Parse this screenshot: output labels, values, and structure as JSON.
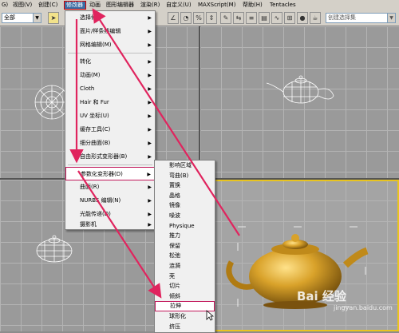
{
  "menubar": {
    "items": [
      {
        "label": "G)"
      },
      {
        "label": "视图(V)"
      },
      {
        "label": "创建(C)"
      },
      {
        "label": "修改器"
      },
      {
        "label": "动画"
      },
      {
        "label": "图形编辑器"
      },
      {
        "label": "渲染(R)"
      },
      {
        "label": "自定义(U)"
      },
      {
        "label": "MAXScript(M)"
      },
      {
        "label": "帮助(H)"
      },
      {
        "label": "Tentacles"
      }
    ]
  },
  "toolbar": {
    "filter_value": "全部",
    "selection_set_placeholder": "创建选择集",
    "colors": {
      "selected_tool": "#f2e28a"
    }
  },
  "modifiers_menu": {
    "items": [
      {
        "label": "选择修",
        "has_sub": true
      },
      {
        "label": "面片/样条线编辑",
        "has_sub": true
      },
      {
        "label": "网格编辑(M)",
        "has_sub": true
      },
      {
        "label": "转化",
        "has_sub": true
      },
      {
        "label": "动画(M)",
        "has_sub": true
      },
      {
        "label": "Cloth",
        "has_sub": true
      },
      {
        "label": "Hair 和 Fur",
        "has_sub": true
      },
      {
        "label": "UV 坐标(U)",
        "has_sub": true
      },
      {
        "label": "缓存工具(C)",
        "has_sub": true
      },
      {
        "label": "细分曲面(B)",
        "has_sub": true
      },
      {
        "label": "自由形式变形器(B)",
        "has_sub": true
      },
      {
        "label": "参数化变形器(D)",
        "has_sub": true,
        "highlighted": true
      },
      {
        "label": "曲面(R)",
        "has_sub": true
      },
      {
        "label": "NURBS 编辑(N)",
        "has_sub": true
      },
      {
        "label": "光能传递(D)",
        "has_sub": true
      },
      {
        "label": "摄影机",
        "has_sub": true
      }
    ]
  },
  "parametric_deformers_menu": {
    "items": [
      {
        "label": "影响区域"
      },
      {
        "label": "弯曲(B)"
      },
      {
        "label": "置换"
      },
      {
        "label": "晶格"
      },
      {
        "label": "镜像"
      },
      {
        "label": "噪波"
      },
      {
        "label": "Physique"
      },
      {
        "label": "推力"
      },
      {
        "label": "保留"
      },
      {
        "label": "松弛"
      },
      {
        "label": "涟漪"
      },
      {
        "label": "壳"
      },
      {
        "label": "切片"
      },
      {
        "label": "倾斜"
      },
      {
        "label": "拉伸",
        "highlighted": true
      },
      {
        "label": "球形化"
      },
      {
        "label": "挤压"
      }
    ]
  },
  "watermark": {
    "text": "Bai 经验",
    "sub": "jingyan.baidu.com"
  },
  "colors": {
    "arrow": "#e0245e",
    "highlight_border": "#c2185b",
    "teapot": "#d9a22a"
  }
}
